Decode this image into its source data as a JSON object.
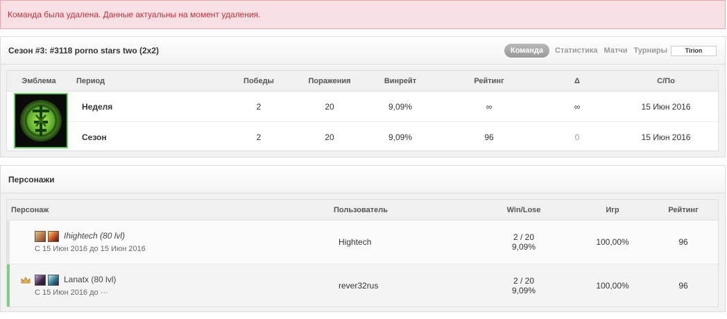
{
  "alert": {
    "text": "Команда была удалена. Данные актуальны на момент удаления."
  },
  "team": {
    "title": "Сезон #3: #3118 porno stars two (2x2)",
    "nav": {
      "active": "Команда",
      "links": [
        "Статистика",
        "Матчи",
        "Турниры"
      ],
      "realm": "Tirion"
    },
    "table": {
      "headers": {
        "emblem": "Эмблема",
        "period": "Период",
        "wins": "Победы",
        "losses": "Поражения",
        "winrate": "Винрейт",
        "rating": "Рейтинг",
        "delta": "Δ",
        "from_to": "С/По"
      },
      "rows": [
        {
          "period": "Неделя",
          "wins": "2",
          "losses": "20",
          "winrate": "9,09%",
          "rating": "∞",
          "delta": "∞",
          "date": "15 Июн 2016"
        },
        {
          "period": "Сезон",
          "wins": "2",
          "losses": "20",
          "winrate": "9,09%",
          "rating": "96",
          "delta": "0",
          "date": "15 Июн 2016"
        }
      ]
    }
  },
  "characters": {
    "title": "Персонажи",
    "headers": {
      "character": "Персонаж",
      "user": "Пользователь",
      "winloss": "Win/Lose",
      "games": "Игр",
      "rating": "Рейтинг"
    },
    "rows": [
      {
        "name": "Ihightech (80 lvl)",
        "dates": "С 15 Июн 2016 до 15 Июн 2016",
        "user": "Hightech",
        "wl": "2 / 20",
        "wl_pct": "9,09%",
        "games": "100,00%",
        "rating": "96"
      },
      {
        "name": "Lanatx (80 lvl)",
        "dates": "С 15 Июн 2016 до ···",
        "user": "rever32rus",
        "wl": "2 / 20",
        "wl_pct": "9,09%",
        "games": "100,00%",
        "rating": "96"
      }
    ]
  },
  "colors": {
    "alert_bg": "#f7e0e3",
    "alert_text": "#c62d3c",
    "highlight_stripe": "#7dce82",
    "emblem_border": "#62d35a"
  }
}
